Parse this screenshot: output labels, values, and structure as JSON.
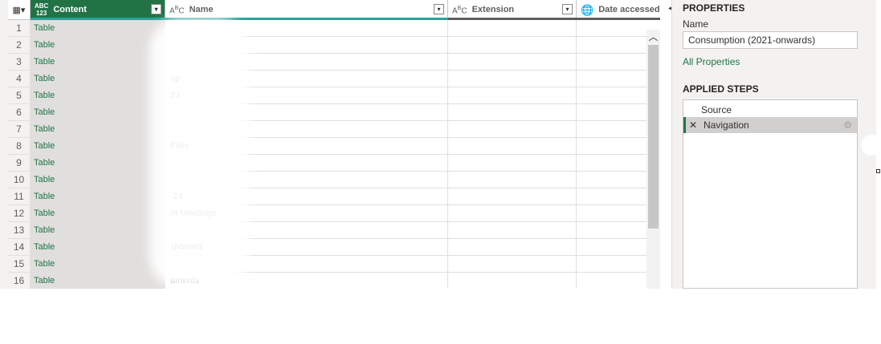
{
  "grid": {
    "columns": [
      {
        "type_icon": "ABC\n123",
        "label": "Content"
      },
      {
        "type_icon": "A B C",
        "label": "Name"
      },
      {
        "type_icon": "A B C",
        "label": "Extension"
      },
      {
        "type_icon": "globe-clock-icon",
        "label": "Date accessed"
      }
    ],
    "rows": [
      {
        "num": "1",
        "content": "Table",
        "name": ""
      },
      {
        "num": "2",
        "content": "Table",
        "name": ""
      },
      {
        "num": "3",
        "content": "Table",
        "name": ""
      },
      {
        "num": "4",
        "content": "Table",
        "name": "up"
      },
      {
        "num": "5",
        "content": "Table",
        "name": "23"
      },
      {
        "num": "6",
        "content": "Table",
        "name": ""
      },
      {
        "num": "7",
        "content": "Table",
        "name": ""
      },
      {
        "num": "8",
        "content": "Table",
        "name": "Files"
      },
      {
        "num": "9",
        "content": "Table",
        "name": ""
      },
      {
        "num": "10",
        "content": "Table",
        "name": ""
      },
      {
        "num": "11",
        "content": "Table",
        "name": "-24"
      },
      {
        "num": "12",
        "content": "Table",
        "name": "nt Meetings"
      },
      {
        "num": "13",
        "content": "Table",
        "name": ""
      },
      {
        "num": "14",
        "content": "Table",
        "name": "shboard"
      },
      {
        "num": "15",
        "content": "Table",
        "name": ""
      },
      {
        "num": "16",
        "content": "Table",
        "name": "uments"
      }
    ]
  },
  "panel": {
    "properties_title": "PROPERTIES",
    "name_label": "Name",
    "name_value": "Consumption (2021-onwards)",
    "all_properties": "All Properties",
    "applied_steps_title": "APPLIED STEPS",
    "steps": [
      {
        "label": "Source"
      },
      {
        "label": "Navigation"
      }
    ]
  },
  "colors": {
    "accent": "#217346",
    "quality_valid": "#2aa198",
    "quality_empty": "#605e5c"
  }
}
